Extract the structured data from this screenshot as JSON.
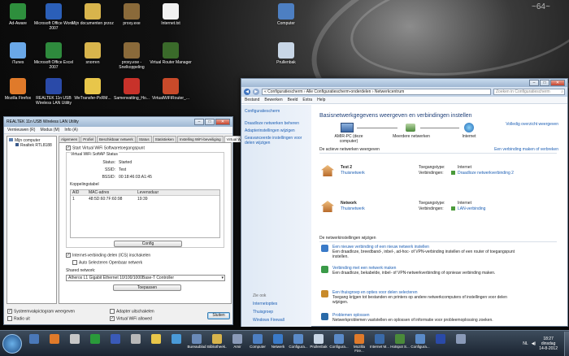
{
  "desktop": {
    "icons": [
      {
        "label": "Ad-Aware",
        "color": "#2e8f3d"
      },
      {
        "label": "Microsoft Office Word 2007",
        "color": "#2b5fb8"
      },
      {
        "label": "Mijn documenten przoz",
        "color": "#d8b44c"
      },
      {
        "label": "proxy.exe",
        "color": "#8a6a3a"
      },
      {
        "label": "Internet.txt",
        "color": "#f2f2f2"
      },
      {
        "label": "Computer",
        "color": "#4d7fc2"
      },
      {
        "label": "iTunes",
        "color": "#6aa8e8"
      },
      {
        "label": "Microsoft Office Excel 2007",
        "color": "#2e8a3d"
      },
      {
        "label": "snorren",
        "color": "#d8b44c"
      },
      {
        "label": "proxy.exe - Snelkoppeling",
        "color": "#8a6a3a"
      },
      {
        "label": "Virtual Router Manager",
        "color": "#3a6a2a"
      },
      {
        "label": "Prullenbak",
        "color": "#c8d6e6"
      },
      {
        "label": "Mozilla Firefox",
        "color": "#e07a2a"
      },
      {
        "label": "REALTEK 11n USB Wireless LAN Utility",
        "color": "#2a4aa8"
      },
      {
        "label": "WeTransfer-PxRM...",
        "color": "#e8c64a"
      },
      {
        "label": "Samenvatting_Ho...",
        "color": "#c8322a"
      },
      {
        "label": "VirtualWiFiRouter_...",
        "color": "#c84a2a"
      }
    ]
  },
  "realtek": {
    "title": "REALTEK 11n USB Wireless LAN Utility",
    "menu": [
      "Vernieuwen (R)",
      "Modus (M)",
      "Info (A)"
    ],
    "tree": {
      "root": "Mijn computer",
      "child": "Realtek RTL8188"
    },
    "tabs": [
      "Algemeen",
      "Profiel",
      "Beschikbaar netwerk",
      "Status",
      "Statistieken",
      "Instelling WiFi-beveiliging",
      "Virtual WiFi"
    ],
    "start_label": "Start Virtual WiFi Softwaretoegangspunt",
    "softap_title": "Virtual WiFi SoftAP Status",
    "status_label": "Status:",
    "status_value": "Started",
    "ssid_label": "SSID:",
    "ssid_value": "Test",
    "bssid_label": "BSSID:",
    "bssid_value": "00:18:46:03:A1:45",
    "table_title": "Koppelingstabel",
    "columns": [
      "AID",
      "MAC-adres",
      "Levensduur"
    ],
    "rows": [
      {
        "aid": "1",
        "mac": "48:5D:60:7F:60:98",
        "life": "19:39"
      }
    ],
    "config_label": "Config",
    "ics_label": "Internet-verbinding delen (ICS) inschakelen",
    "auto_label": "Auto Selecteren Openbaar netwerk",
    "shared_label": "Shared network:",
    "shared_value": "Atheros L1 Gigabit Ethernet 10/100/1000Base-T Controller",
    "apply_label": "Toepassen",
    "tray_label": "Systeemvakpictogram weergeven",
    "radio_off_label": "Radio uit",
    "adapter_off_label": "Adapter uitschakelen",
    "vwifi_label": "Virtual WiFi allowed",
    "close_label": "Sluiten"
  },
  "control": {
    "breadcrumb": "« Configuratiescherm › Alle Configuratiescherm-onderdelen › Netwerkcentrum",
    "search_placeholder": "Zoeken in Configuratiescherm",
    "menu": [
      "Bestand",
      "Bewerken",
      "Beeld",
      "Extra",
      "Help"
    ],
    "sidebar_home": "Configuratiescherm",
    "sidebar_links": [
      "Draadloze netwerken beheren",
      "Adapterinstellingen wijzigen",
      "Geavanceerde instellingen voor delen wijzigen"
    ],
    "see_also": "Zie ook",
    "see_also_links": [
      "Internetopties",
      "Thuisgroep",
      "Windows Firewall"
    ],
    "heading": "Basisnetwerkgegevens weergeven en verbindingen instellen",
    "full_map": "Volledig overzicht weergeven",
    "map_pc": "AMIR-PC (deze computer)",
    "map_multi": "Meerdere netwerken",
    "map_inet": "Internet",
    "active_label": "De actieve netwerken weergeven",
    "connect_disconnect": "Een verbinding maken of verbreken",
    "networks": [
      {
        "name": "Test  2",
        "type": "Thuisnetwerk",
        "access_label": "Toegangstype:",
        "access": "Internet",
        "conn_label": "Verbindingen:",
        "conn": "Draadloze netwerkverbinding 2"
      },
      {
        "name": "Network",
        "type": "Thuisnetwerk",
        "access_label": "Toegangstype:",
        "access": "Internet",
        "conn_label": "Verbindingen:",
        "conn": "LAN-verbinding"
      }
    ],
    "change_label": "De netwerkinstellingen wijzigen",
    "tasks": [
      {
        "title": "Een nieuwe verbinding of een nieuw netwerk instellen",
        "desc": "Een draadloze, breedband-, inbel-, ad-hoc- of VPN-verbinding instellen of een router of toegangspunt instellen."
      },
      {
        "title": "Verbinding met een netwerk maken",
        "desc": "Een draadloze, bekabelde, inbel- of VPN-netwerkverbinding of opnieuw verbinding maken."
      },
      {
        "title": "Een thuisgroep en opties voor delen selecteren",
        "desc": "Toegang krijgen tot bestanden en printers op andere netwerkcomputers of instellingen voor delen wijzigen."
      },
      {
        "title": "Problemen oplossen",
        "desc": "Netwerkproblemen vaststellen en oplossen of informatie voor probleemoplossing zoeken."
      }
    ]
  },
  "taskbar": {
    "items": [
      "",
      "",
      "",
      "",
      "",
      "",
      "",
      "",
      "Bureaublad",
      "Bibliotheek...",
      "Amir",
      "Computer",
      "Netwerk",
      "Configura...",
      "Prullenbak",
      "Configura...",
      "Mozilla Fire...",
      "Internet M...",
      "Hotspot S...",
      "Configura...",
      "",
      ""
    ],
    "lang": "NL",
    "time": "18:27",
    "day": "dinsdag",
    "date": "14-8-2012"
  }
}
